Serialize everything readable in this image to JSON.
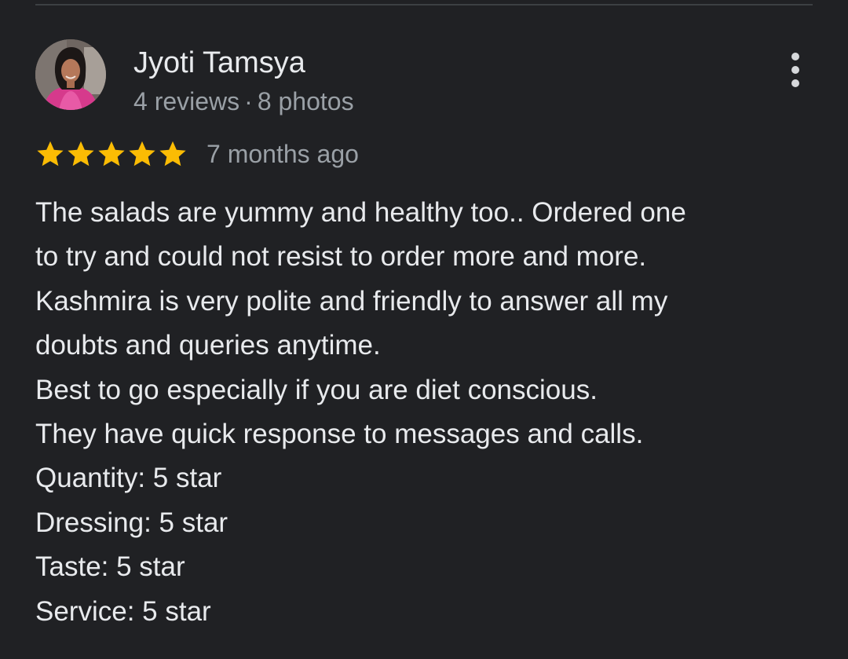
{
  "review": {
    "author": {
      "name": "Jyoti Tamsya",
      "reviews_count": "4 reviews",
      "separator": "·",
      "photos_count": "8 photos",
      "avatar_icon": "user-avatar-photo"
    },
    "rating": {
      "stars": 5,
      "max_stars": 5,
      "star_color": "#fbbc04"
    },
    "date": "7 months ago",
    "body_lines": [
      "The salads are yummy and healthy too.. Ordered one",
      "to try and could not resist to order more and more.",
      "Kashmira is very polite and friendly to answer all my",
      "doubts and queries anytime.",
      "Best to go especially if you are diet conscious.",
      "They have quick response to messages and calls.",
      "Quantity: 5 star",
      "Dressing: 5 star",
      "Taste: 5 star",
      "Service: 5 star"
    ],
    "more_icon": "more-vertical-icon"
  },
  "colors": {
    "background": "#202124",
    "text_primary": "#e8eaed",
    "text_secondary": "#9aa0a6",
    "divider": "#3c4043"
  }
}
